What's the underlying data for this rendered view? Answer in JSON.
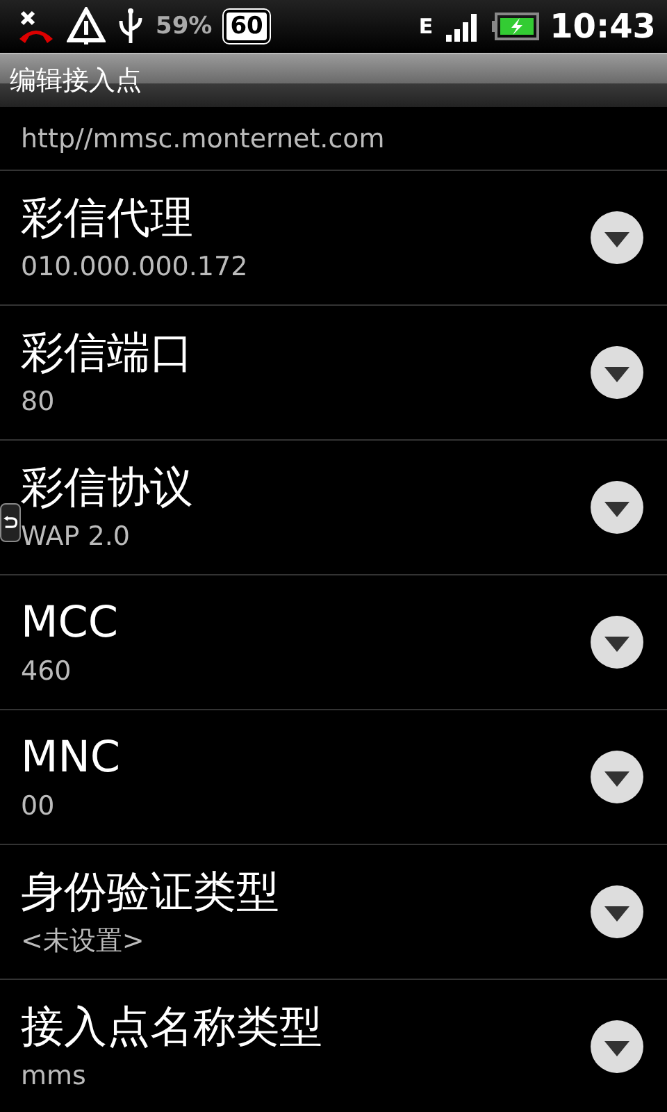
{
  "status_bar": {
    "battery_percent": "59%",
    "badge": "60",
    "network": "E",
    "time": "10:43"
  },
  "title": "编辑接入点",
  "partial_row": {
    "value": "http//mmsc.monternet.com"
  },
  "rows": [
    {
      "label": "彩信代理",
      "value": "010.000.000.172"
    },
    {
      "label": "彩信端口",
      "value": "80"
    },
    {
      "label": "彩信协议",
      "value": "WAP 2.0"
    },
    {
      "label": "MCC",
      "value": "460"
    },
    {
      "label": "MNC",
      "value": "00"
    },
    {
      "label": "身份验证类型",
      "value": "<未设置>"
    },
    {
      "label": "接入点名称类型",
      "value": "mms"
    }
  ]
}
